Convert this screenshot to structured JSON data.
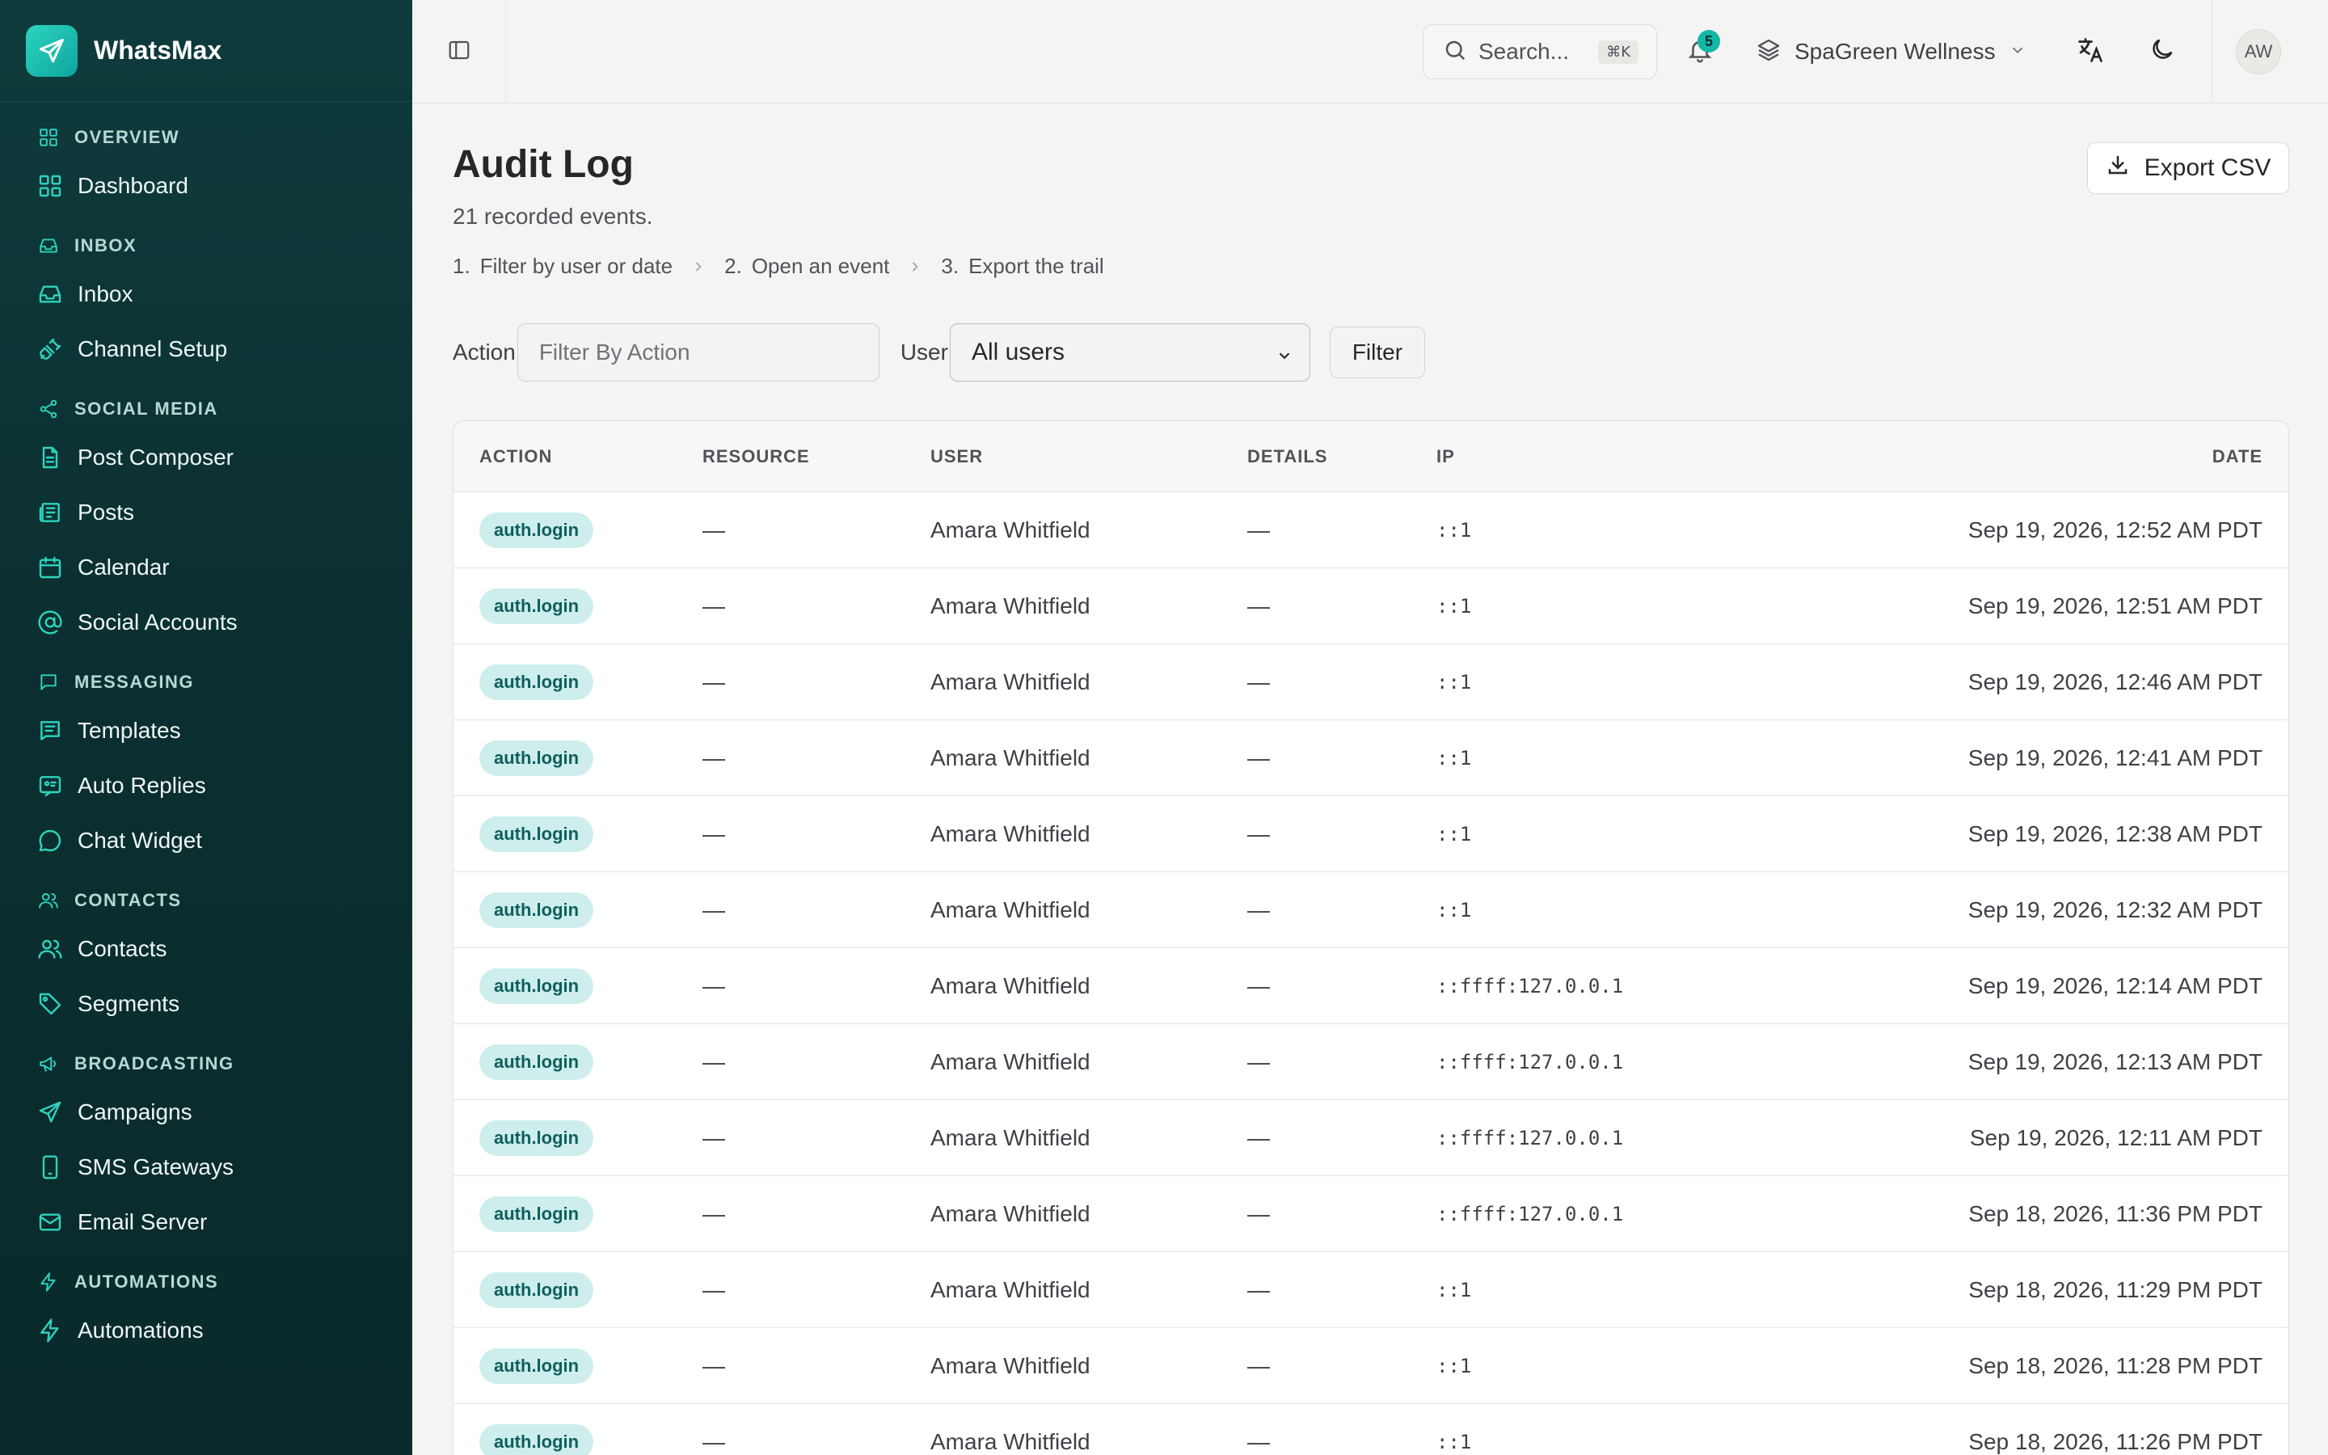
{
  "brand": {
    "name": "WhatsMax"
  },
  "sidebar": {
    "sections": [
      {
        "label": "OVERVIEW",
        "icon": "grid-icon",
        "items": [
          {
            "label": "Dashboard",
            "icon": "grid-icon"
          }
        ]
      },
      {
        "label": "INBOX",
        "icon": "inbox-icon",
        "items": [
          {
            "label": "Inbox",
            "icon": "inbox-icon"
          },
          {
            "label": "Channel Setup",
            "icon": "plug-icon"
          }
        ]
      },
      {
        "label": "SOCIAL MEDIA",
        "icon": "share-icon",
        "items": [
          {
            "label": "Post Composer",
            "icon": "document-icon"
          },
          {
            "label": "Posts",
            "icon": "newspaper-icon"
          },
          {
            "label": "Calendar",
            "icon": "calendar-icon"
          },
          {
            "label": "Social Accounts",
            "icon": "at-sign-icon"
          }
        ]
      },
      {
        "label": "MESSAGING",
        "icon": "message-square-icon",
        "items": [
          {
            "label": "Templates",
            "icon": "template-icon"
          },
          {
            "label": "Auto Replies",
            "icon": "auto-reply-icon"
          },
          {
            "label": "Chat Widget",
            "icon": "chat-bubble-icon"
          }
        ]
      },
      {
        "label": "CONTACTS",
        "icon": "users-icon",
        "items": [
          {
            "label": "Contacts",
            "icon": "users-icon"
          },
          {
            "label": "Segments",
            "icon": "tag-icon"
          }
        ]
      },
      {
        "label": "BROADCASTING",
        "icon": "megaphone-icon",
        "items": [
          {
            "label": "Campaigns",
            "icon": "send-icon"
          },
          {
            "label": "SMS Gateways",
            "icon": "smartphone-icon"
          },
          {
            "label": "Email Server",
            "icon": "mail-icon"
          }
        ]
      },
      {
        "label": "AUTOMATIONS",
        "icon": "zap-icon",
        "items": [
          {
            "label": "Automations",
            "icon": "zap-icon"
          }
        ]
      }
    ]
  },
  "topbar": {
    "search_placeholder": "Search...",
    "search_shortcut": "⌘K",
    "notification_count": "5",
    "workspace": "SpaGreen Wellness",
    "avatar_initials": "AW"
  },
  "page": {
    "title": "Audit Log",
    "subtitle": "21 recorded events.",
    "export_label": "Export CSV",
    "steps": [
      {
        "num": "1.",
        "label": "Filter by user or date"
      },
      {
        "num": "2.",
        "label": "Open an event"
      },
      {
        "num": "3.",
        "label": "Export the trail"
      }
    ]
  },
  "filters": {
    "action_label": "Action",
    "action_placeholder": "Filter By Action",
    "user_label": "User",
    "user_selected": "All users",
    "filter_button": "Filter"
  },
  "table": {
    "columns": [
      "ACTION",
      "RESOURCE",
      "USER",
      "DETAILS",
      "IP",
      "DATE"
    ],
    "rows": [
      {
        "action": "auth.login",
        "resource": "—",
        "user": "Amara Whitfield",
        "details": "—",
        "ip": "::1",
        "date": "Sep 19, 2026, 12:52 AM PDT"
      },
      {
        "action": "auth.login",
        "resource": "—",
        "user": "Amara Whitfield",
        "details": "—",
        "ip": "::1",
        "date": "Sep 19, 2026, 12:51 AM PDT"
      },
      {
        "action": "auth.login",
        "resource": "—",
        "user": "Amara Whitfield",
        "details": "—",
        "ip": "::1",
        "date": "Sep 19, 2026, 12:46 AM PDT"
      },
      {
        "action": "auth.login",
        "resource": "—",
        "user": "Amara Whitfield",
        "details": "—",
        "ip": "::1",
        "date": "Sep 19, 2026, 12:41 AM PDT"
      },
      {
        "action": "auth.login",
        "resource": "—",
        "user": "Amara Whitfield",
        "details": "—",
        "ip": "::1",
        "date": "Sep 19, 2026, 12:38 AM PDT"
      },
      {
        "action": "auth.login",
        "resource": "—",
        "user": "Amara Whitfield",
        "details": "—",
        "ip": "::1",
        "date": "Sep 19, 2026, 12:32 AM PDT"
      },
      {
        "action": "auth.login",
        "resource": "—",
        "user": "Amara Whitfield",
        "details": "—",
        "ip": "::ffff:127.0.0.1",
        "date": "Sep 19, 2026, 12:14 AM PDT"
      },
      {
        "action": "auth.login",
        "resource": "—",
        "user": "Amara Whitfield",
        "details": "—",
        "ip": "::ffff:127.0.0.1",
        "date": "Sep 19, 2026, 12:13 AM PDT"
      },
      {
        "action": "auth.login",
        "resource": "—",
        "user": "Amara Whitfield",
        "details": "—",
        "ip": "::ffff:127.0.0.1",
        "date": "Sep 19, 2026, 12:11 AM PDT"
      },
      {
        "action": "auth.login",
        "resource": "—",
        "user": "Amara Whitfield",
        "details": "—",
        "ip": "::ffff:127.0.0.1",
        "date": "Sep 18, 2026, 11:36 PM PDT"
      },
      {
        "action": "auth.login",
        "resource": "—",
        "user": "Amara Whitfield",
        "details": "—",
        "ip": "::1",
        "date": "Sep 18, 2026, 11:29 PM PDT"
      },
      {
        "action": "auth.login",
        "resource": "—",
        "user": "Amara Whitfield",
        "details": "—",
        "ip": "::1",
        "date": "Sep 18, 2026, 11:28 PM PDT"
      },
      {
        "action": "auth.login",
        "resource": "—",
        "user": "Amara Whitfield",
        "details": "—",
        "ip": "::1",
        "date": "Sep 18, 2026, 11:26 PM PDT"
      }
    ]
  },
  "colors": {
    "accent": "#14b8a6",
    "sidebar_bg": "#0f3b3c",
    "pill_bg": "#cdeeed",
    "pill_text": "#0f5f5c"
  }
}
